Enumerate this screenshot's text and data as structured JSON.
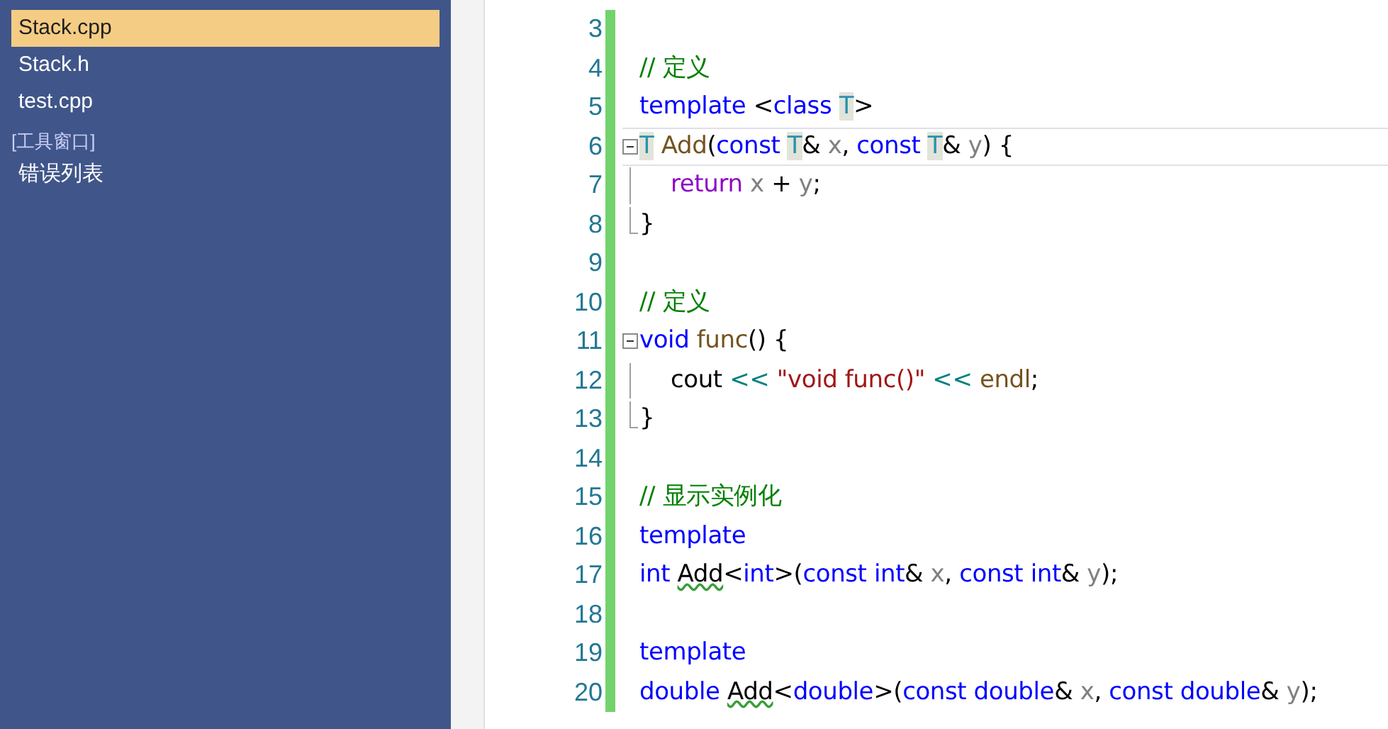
{
  "sidebar": {
    "items": [
      {
        "kind": "file",
        "label": "Stack.cpp",
        "selected": true
      },
      {
        "kind": "file",
        "label": "Stack.h",
        "selected": false
      },
      {
        "kind": "file",
        "label": "test.cpp",
        "selected": false
      },
      {
        "kind": "header",
        "label": "[工具窗口]",
        "selected": false
      },
      {
        "kind": "file",
        "label": "错误列表",
        "selected": false
      }
    ]
  },
  "editor": {
    "lines": [
      {
        "number": "3",
        "kind": "plain",
        "current": false
      },
      {
        "number": "4",
        "kind": "plain",
        "current": false,
        "tokens": [
          {
            "text": "// 定义",
            "kind": "comment"
          }
        ]
      },
      {
        "number": "5",
        "kind": "plain",
        "current": false,
        "tokens": [
          {
            "text": "template",
            "kind": "kw"
          },
          {
            "text": " <",
            "kind": "plain"
          },
          {
            "text": "class ",
            "kind": "kw"
          },
          {
            "text": "T",
            "kind": "tparam"
          },
          {
            "text": ">",
            "kind": "plain"
          }
        ]
      },
      {
        "number": "6",
        "kind": "fold-start",
        "current": true,
        "tokens": [
          {
            "text": "T",
            "kind": "tparam"
          },
          {
            "text": " Add",
            "kind": "fn"
          },
          {
            "text": "(",
            "kind": "plain"
          },
          {
            "text": "const ",
            "kind": "kw"
          },
          {
            "text": "T",
            "kind": "tparam"
          },
          {
            "text": "& ",
            "kind": "plain"
          },
          {
            "text": "x",
            "kind": "param"
          },
          {
            "text": ", ",
            "kind": "plain"
          },
          {
            "text": "const ",
            "kind": "kw"
          },
          {
            "text": "T",
            "kind": "tparam"
          },
          {
            "text": "& ",
            "kind": "plain"
          },
          {
            "text": "y",
            "kind": "param"
          },
          {
            "text": ") {",
            "kind": "plain"
          }
        ]
      },
      {
        "number": "7",
        "kind": "fold-body",
        "current": false,
        "tokens": [
          {
            "text": "return ",
            "kind": "ctrl"
          },
          {
            "text": "x",
            "kind": "param"
          },
          {
            "text": " + ",
            "kind": "plain"
          },
          {
            "text": "y",
            "kind": "param"
          },
          {
            "text": ";",
            "kind": "plain"
          }
        ]
      },
      {
        "number": "8",
        "kind": "fold-end",
        "current": false,
        "tokens": [
          {
            "text": "}",
            "kind": "plain"
          }
        ]
      },
      {
        "number": "9",
        "kind": "plain",
        "current": false
      },
      {
        "number": "10",
        "kind": "plain",
        "current": false,
        "tokens": [
          {
            "text": "// 定义",
            "kind": "comment"
          }
        ]
      },
      {
        "number": "11",
        "kind": "fold-start",
        "current": false,
        "tokens": [
          {
            "text": "void",
            "kind": "kw"
          },
          {
            "text": " func",
            "kind": "fn"
          },
          {
            "text": "() {",
            "kind": "plain"
          }
        ]
      },
      {
        "number": "12",
        "kind": "fold-body",
        "current": false,
        "tokens": [
          {
            "text": "cout ",
            "kind": "plain"
          },
          {
            "text": "<< ",
            "kind": "op"
          },
          {
            "text": "\"void func()\"",
            "kind": "str"
          },
          {
            "text": " <<",
            "kind": "op"
          },
          {
            "text": " endl",
            "kind": "fn"
          },
          {
            "text": ";",
            "kind": "plain"
          }
        ]
      },
      {
        "number": "13",
        "kind": "fold-end",
        "current": false,
        "tokens": [
          {
            "text": "}",
            "kind": "plain"
          }
        ]
      },
      {
        "number": "14",
        "kind": "plain",
        "current": false
      },
      {
        "number": "15",
        "kind": "plain",
        "current": false,
        "tokens": [
          {
            "text": "// 显示实例化",
            "kind": "comment"
          }
        ]
      },
      {
        "number": "16",
        "kind": "plain",
        "current": false,
        "tokens": [
          {
            "text": "template",
            "kind": "kw"
          }
        ]
      },
      {
        "number": "17",
        "kind": "plain",
        "current": false,
        "tokens": [
          {
            "text": "int ",
            "kind": "kw"
          },
          {
            "text": "Add",
            "kind": "squiggle"
          },
          {
            "text": "<",
            "kind": "plain"
          },
          {
            "text": "int",
            "kind": "kw"
          },
          {
            "text": ">(",
            "kind": "plain"
          },
          {
            "text": "const int",
            "kind": "kw"
          },
          {
            "text": "& ",
            "kind": "plain"
          },
          {
            "text": "x",
            "kind": "param"
          },
          {
            "text": ", ",
            "kind": "plain"
          },
          {
            "text": "const int",
            "kind": "kw"
          },
          {
            "text": "& ",
            "kind": "plain"
          },
          {
            "text": "y",
            "kind": "param"
          },
          {
            "text": ");",
            "kind": "plain"
          }
        ]
      },
      {
        "number": "18",
        "kind": "plain",
        "current": false
      },
      {
        "number": "19",
        "kind": "plain",
        "current": false,
        "tokens": [
          {
            "text": "template",
            "kind": "kw"
          }
        ]
      },
      {
        "number": "20",
        "kind": "plain",
        "current": false,
        "tokens": [
          {
            "text": "double ",
            "kind": "kw"
          },
          {
            "text": "Add",
            "kind": "squiggle"
          },
          {
            "text": "<",
            "kind": "plain"
          },
          {
            "text": "double",
            "kind": "kw"
          },
          {
            "text": ">(",
            "kind": "plain"
          },
          {
            "text": "const double",
            "kind": "kw"
          },
          {
            "text": "& ",
            "kind": "plain"
          },
          {
            "text": "x",
            "kind": "param"
          },
          {
            "text": ", ",
            "kind": "plain"
          },
          {
            "text": "const double",
            "kind": "kw"
          },
          {
            "text": "& ",
            "kind": "plain"
          },
          {
            "text": "y",
            "kind": "param"
          },
          {
            "text": ");",
            "kind": "plain"
          }
        ]
      }
    ]
  }
}
